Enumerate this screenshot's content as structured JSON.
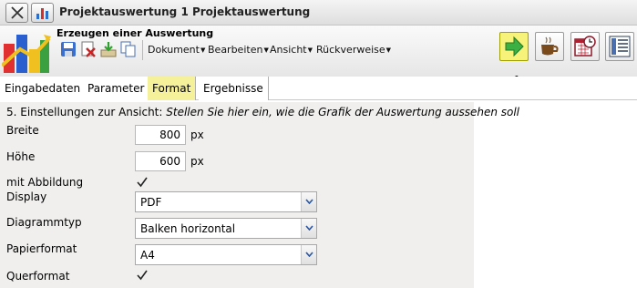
{
  "window": {
    "title": "Projektauswertung 1 Projektauswertung"
  },
  "toolbar": {
    "subtitle": "Erzeugen einer Auswertung",
    "menus": [
      "Dokument",
      "Bearbeiten",
      "Ansicht",
      "Rückverweise"
    ]
  },
  "tabs": [
    "Eingabedaten",
    "Parameter",
    "Format",
    "Ergebnisse"
  ],
  "active_tab": "Format",
  "section": {
    "heading": "5. Einstellungen zur Ansicht:",
    "heading_note": "Stellen Sie hier ein, wie die Grafik der Auswertung aussehen soll"
  },
  "form": {
    "breite": {
      "label": "Breite",
      "value": "800",
      "unit": "px"
    },
    "hoehe": {
      "label": "Höhe",
      "value": "600",
      "unit": "px"
    },
    "mit_abbildung": {
      "label": "mit Abbildung",
      "checked": true
    },
    "display": {
      "label": "Display",
      "value": "PDF"
    },
    "diagrammtyp": {
      "label": "Diagrammtyp",
      "value": "Balken horizontal"
    },
    "papierformat": {
      "label": "Papierformat",
      "value": "A4"
    },
    "querformat": {
      "label": "Querformat",
      "checked": true
    }
  },
  "colors": {
    "active_tab": "#f5f09a",
    "run_button": "#f7f27a",
    "panel": "#f0efee"
  }
}
